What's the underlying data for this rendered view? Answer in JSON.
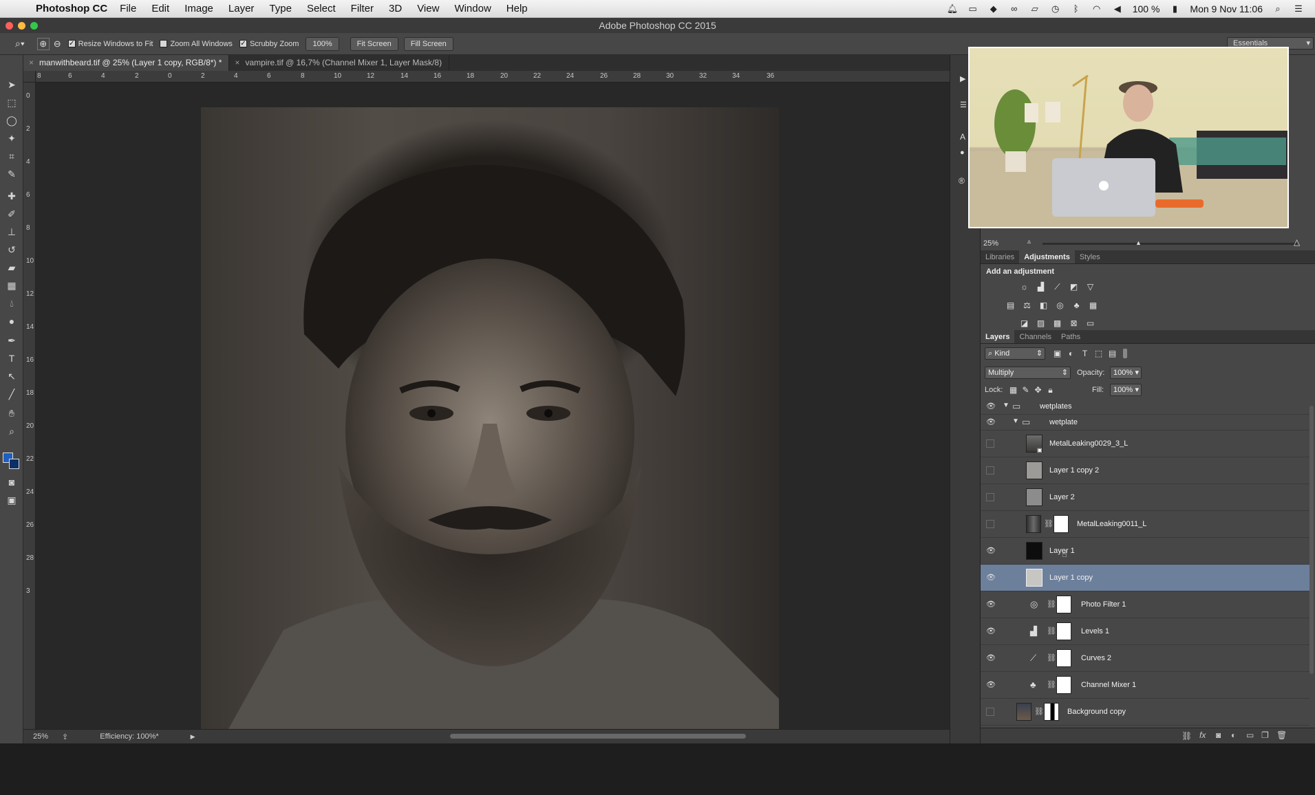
{
  "menubar": {
    "app_name": "Photoshop CC",
    "items": [
      "File",
      "Edit",
      "Image",
      "Layer",
      "Type",
      "Select",
      "Filter",
      "3D",
      "View",
      "Window",
      "Help"
    ],
    "battery": "100 %",
    "datetime": "Mon 9 Nov  11:06"
  },
  "window": {
    "title": "Adobe Photoshop CC 2015"
  },
  "options": {
    "resize_windows": "Resize Windows to Fit",
    "zoom_all": "Zoom All Windows",
    "scrubby": "Scrubby Zoom",
    "zoom_value": "100%",
    "fit_screen": "Fit Screen",
    "fill_screen": "Fill Screen",
    "workspace": "Essentials"
  },
  "tabs": [
    {
      "label": "manwithbeard.tif @ 25% (Layer 1 copy, RGB/8*) *"
    },
    {
      "label": "vampire.tif @ 16,7% (Channel Mixer 1, Layer Mask/8)"
    }
  ],
  "ruler_h": [
    "8",
    "6",
    "4",
    "2",
    "0",
    "2",
    "4",
    "6",
    "8",
    "10",
    "12",
    "14",
    "16",
    "18",
    "20",
    "22",
    "24",
    "26",
    "28",
    "30",
    "32",
    "34",
    "36"
  ],
  "ruler_v": [
    "0",
    "2",
    "4",
    "6",
    "8",
    "10",
    "12",
    "14",
    "16",
    "18",
    "20",
    "22",
    "24",
    "26",
    "28",
    "3"
  ],
  "status": {
    "zoom": "25%",
    "efficiency": "Efficiency: 100%*"
  },
  "navigator": {
    "zoom": "25%"
  },
  "adjustments": {
    "tabs": [
      "Libraries",
      "Adjustments",
      "Styles"
    ],
    "heading": "Add an adjustment"
  },
  "layers_panel": {
    "tabs": [
      "Layers",
      "Channels",
      "Paths"
    ],
    "kind_filter": "Kind",
    "blend_mode": "Multiply",
    "opacity_label": "Opacity:",
    "opacity": "100%",
    "lock_label": "Lock:",
    "fill_label": "Fill:",
    "fill": "100%",
    "layers": [
      {
        "name": "wetplates",
        "type": "group",
        "visible": true
      },
      {
        "name": "wetplate",
        "type": "group",
        "visible": true
      },
      {
        "name": "MetalLeaking0029_3_L",
        "type": "smart",
        "visible": false
      },
      {
        "name": "Layer 1 copy 2",
        "type": "pixel",
        "visible": false
      },
      {
        "name": "Layer 2",
        "type": "pixel",
        "visible": false
      },
      {
        "name": "MetalLeaking0011_L",
        "type": "masked",
        "visible": false
      },
      {
        "name": "Layer 1",
        "type": "pixel",
        "visible": true
      },
      {
        "name": "Layer 1 copy",
        "type": "pixel",
        "visible": true,
        "selected": true
      },
      {
        "name": "Photo Filter 1",
        "type": "adjustment",
        "visible": true
      },
      {
        "name": "Levels 1",
        "type": "adjustment",
        "visible": true
      },
      {
        "name": "Curves 2",
        "type": "adjustment",
        "visible": true
      },
      {
        "name": "Channel Mixer 1",
        "type": "adjustment",
        "visible": true
      },
      {
        "name": "Background copy",
        "type": "masked",
        "visible": false
      }
    ]
  },
  "colors": {
    "selected_layer": "#6c7f9b",
    "panel_bg": "#474747",
    "canvas_bg": "#282828",
    "foreground_color": "#1e5fbf"
  }
}
